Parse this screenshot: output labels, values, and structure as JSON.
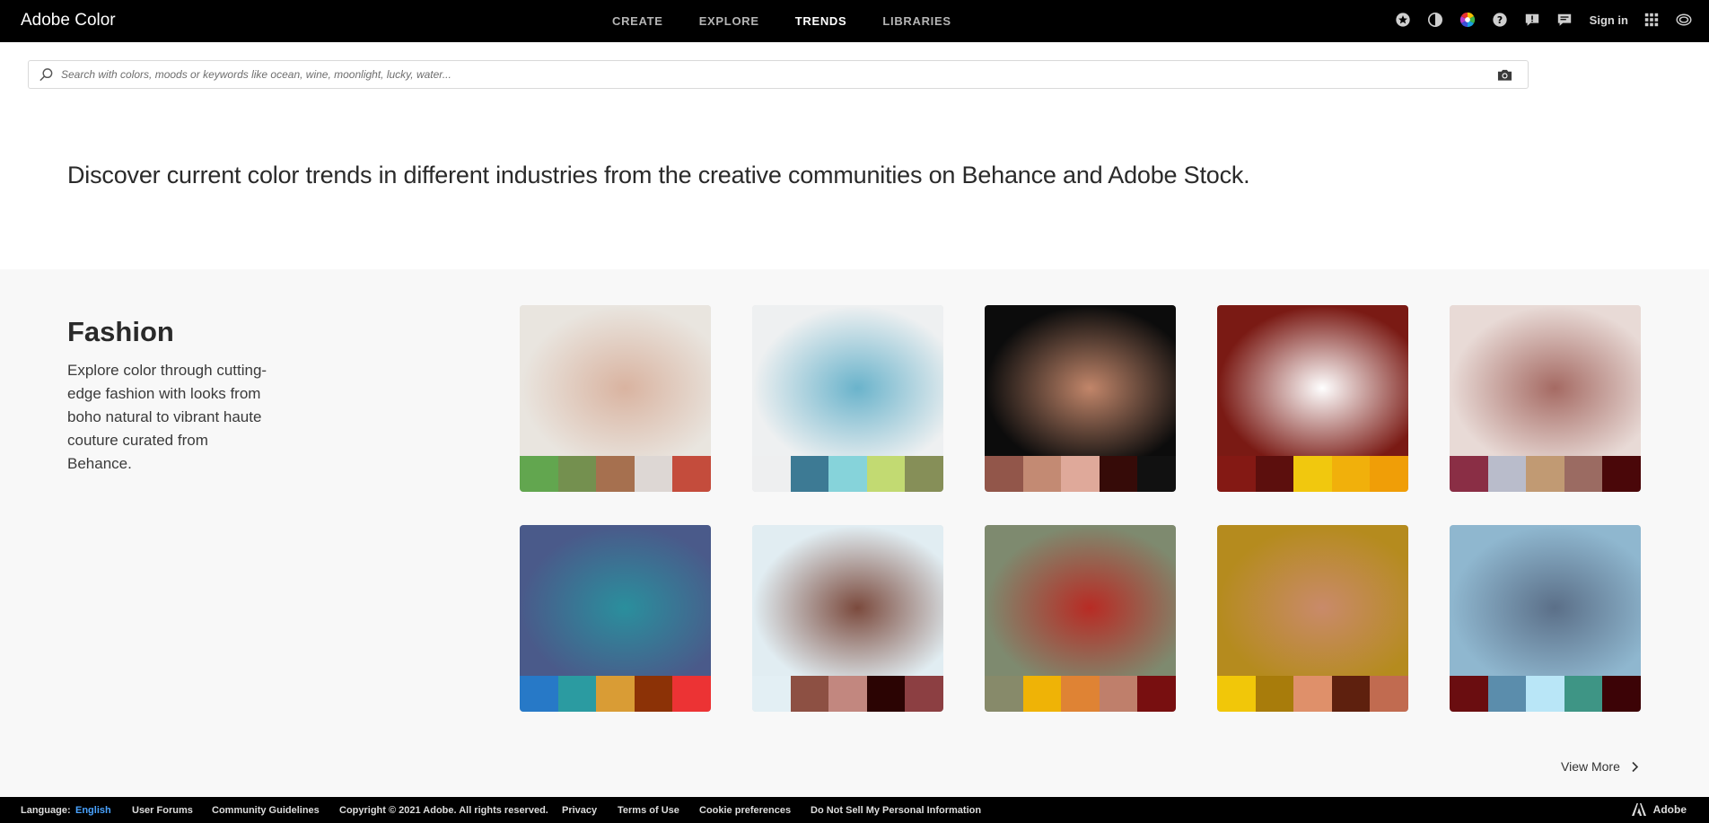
{
  "app": {
    "title": "Adobe Color"
  },
  "nav": {
    "tabs": [
      {
        "label": "CREATE",
        "active": false
      },
      {
        "label": "EXPLORE",
        "active": false
      },
      {
        "label": "TRENDS",
        "active": true
      },
      {
        "label": "LIBRARIES",
        "active": false
      }
    ]
  },
  "tools": {
    "icons": [
      "star-icon",
      "contrast-icon",
      "color-wheel-icon",
      "help-icon",
      "feedback-icon",
      "chat-icon"
    ],
    "signin_label": "Sign in",
    "extra_icons": [
      "apps-grid-icon",
      "creative-cloud-icon"
    ]
  },
  "search": {
    "placeholder": "Search with colors, moods or keywords like ocean, wine, moonlight, lucky, water...",
    "value": ""
  },
  "hero": {
    "text": "Discover current color trends in different industries from the creative communities on Behance and Adobe Stock."
  },
  "section": {
    "title": "Fashion",
    "description": "Explore color through cutting-edge fashion with looks from boho natural to vibrant haute couture curated from Behance.",
    "view_more": "View More"
  },
  "cards": [
    {
      "photo_bg": [
        "#e9e5df",
        "#d9b3a0"
      ],
      "swatches": [
        "#62a64f",
        "#74904f",
        "#a6704f",
        "#ddd7d4",
        "#c44c3c"
      ]
    },
    {
      "photo_bg": [
        "#eef0f1",
        "#6ab3cb"
      ],
      "swatches": [
        "#eeeff0",
        "#3d7a94",
        "#86d3da",
        "#c2da72",
        "#868f58"
      ]
    },
    {
      "photo_bg": [
        "#0c0c0c",
        "#c2866a"
      ],
      "swatches": [
        "#92564a",
        "#c38a73",
        "#dfa99a",
        "#360b08",
        "#111111"
      ]
    },
    {
      "photo_bg": [
        "#7a1a14",
        "#ffffff"
      ],
      "swatches": [
        "#841914",
        "#5c0f0d",
        "#f1c80e",
        "#f1b00b",
        "#f09e07"
      ]
    },
    {
      "photo_bg": [
        "#e8dad6",
        "#a56a63"
      ],
      "swatches": [
        "#8a2e45",
        "#b9bccb",
        "#c19a73",
        "#9b6b62",
        "#4a0709"
      ]
    },
    {
      "photo_bg": [
        "#4a5a8a",
        "#2a8f9d"
      ],
      "swatches": [
        "#2779c7",
        "#2b9ba1",
        "#d99c35",
        "#8c3206",
        "#ec3334"
      ]
    },
    {
      "photo_bg": [
        "#e1edf2",
        "#7b4a3d"
      ],
      "swatches": [
        "#e3eff4",
        "#8d5043",
        "#c2877f",
        "#2b0403",
        "#8c3f42"
      ]
    },
    {
      "photo_bg": [
        "#7e8a6f",
        "#b82b24"
      ],
      "swatches": [
        "#878a6a",
        "#efb306",
        "#df8334",
        "#bf7f6b",
        "#780f10"
      ]
    },
    {
      "photo_bg": [
        "#b58b1e",
        "#c98a6a"
      ],
      "swatches": [
        "#f1c709",
        "#a87c0b",
        "#df906a",
        "#5e200e",
        "#c16b50"
      ]
    },
    {
      "photo_bg": [
        "#8fb7cf",
        "#5b6f88"
      ],
      "swatches": [
        "#6a0d10",
        "#5b8dac",
        "#b9e6f7",
        "#3e9585",
        "#3c0306"
      ]
    }
  ],
  "footer": {
    "language_label": "Language:",
    "language_value": "English",
    "links": [
      "User Forums",
      "Community Guidelines",
      "Copyright © 2021 Adobe. All rights reserved.",
      "Privacy",
      "Terms of Use",
      "Cookie preferences",
      "Do Not Sell My Personal Information"
    ],
    "brand": "Adobe"
  }
}
